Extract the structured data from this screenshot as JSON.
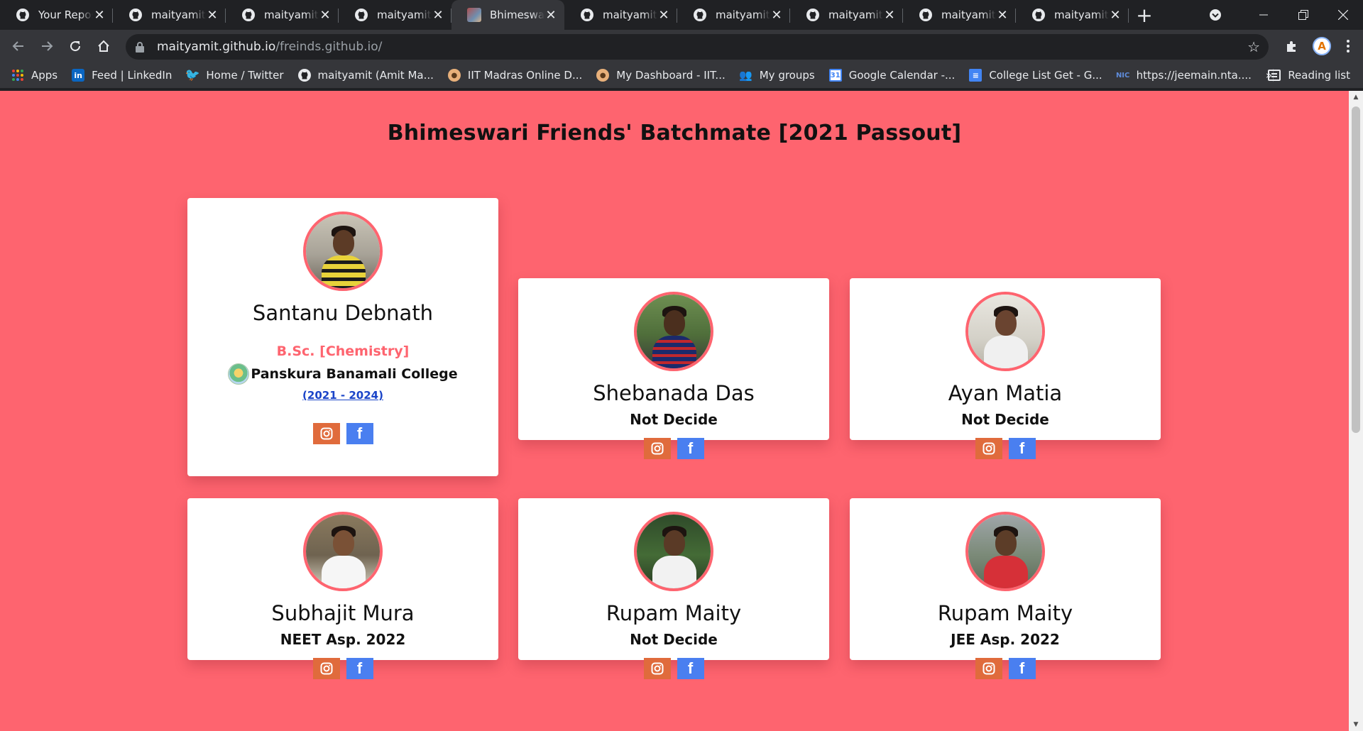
{
  "tabs": [
    {
      "title": "Your Repositories",
      "icon": "github-icon",
      "active": false
    },
    {
      "title": "maityamit/Code",
      "icon": "github-icon",
      "active": false
    },
    {
      "title": "maityamit/freinds",
      "icon": "github-icon",
      "active": false
    },
    {
      "title": "maityamit/freinds",
      "icon": "github-icon",
      "active": false
    },
    {
      "title": "Bhimeswari Friends",
      "icon": "site-icon",
      "active": true
    },
    {
      "title": "maityamit/freinds",
      "icon": "github-icon",
      "active": false
    },
    {
      "title": "maityamit/codes",
      "icon": "github-icon",
      "active": false
    },
    {
      "title": "maityamit/codes",
      "icon": "github-icon",
      "active": false
    },
    {
      "title": "maityamit/web",
      "icon": "github-icon",
      "active": false
    },
    {
      "title": "maityamit/Java",
      "icon": "github-icon",
      "active": false
    }
  ],
  "address": {
    "host": "maityamit.github.io",
    "path": "/freinds.github.io/"
  },
  "bookmarks": [
    {
      "label": "Apps",
      "icon": "apps-grid-icon"
    },
    {
      "label": "Feed | LinkedIn",
      "icon": "linkedin-icon"
    },
    {
      "label": "Home / Twitter",
      "icon": "twitter-icon"
    },
    {
      "label": "maityamit (Amit Ma...",
      "icon": "github-icon"
    },
    {
      "label": "IIT Madras Online D...",
      "icon": "emoji-icon"
    },
    {
      "label": "My Dashboard - IIT...",
      "icon": "emoji-icon"
    },
    {
      "label": "My groups",
      "icon": "groups-icon"
    },
    {
      "label": "Google Calendar -...",
      "icon": "calendar-icon"
    },
    {
      "label": "College List Get - G...",
      "icon": "docs-icon"
    },
    {
      "label": "https://jeemain.nta....",
      "icon": "nic-icon"
    }
  ],
  "bookmarks_overflow": "»",
  "reading_list": "Reading list",
  "page": {
    "title": "Bhimeswari Friends' Batchmate [2021 Passout]",
    "featured": {
      "name": "Santanu Debnath",
      "degree": "B.Sc. [Chemistry]",
      "college": "Panskura Banamali College",
      "years": "(2021 - 2024)"
    },
    "friends": [
      {
        "name": "Shebanada Das",
        "status": "Not Decide"
      },
      {
        "name": "Ayan Matia",
        "status": "Not Decide"
      },
      {
        "name": "Subhajit Mura",
        "status": "NEET Asp. 2022"
      },
      {
        "name": "Rupam Maity",
        "status": "Not Decide"
      },
      {
        "name": "Rupam Maity",
        "status": "JEE Asp. 2022"
      }
    ]
  },
  "colors": {
    "page_bg": "#fe646f",
    "instagram": "#e06b3c",
    "facebook": "#4a7ff0",
    "link": "#1a44c8"
  }
}
